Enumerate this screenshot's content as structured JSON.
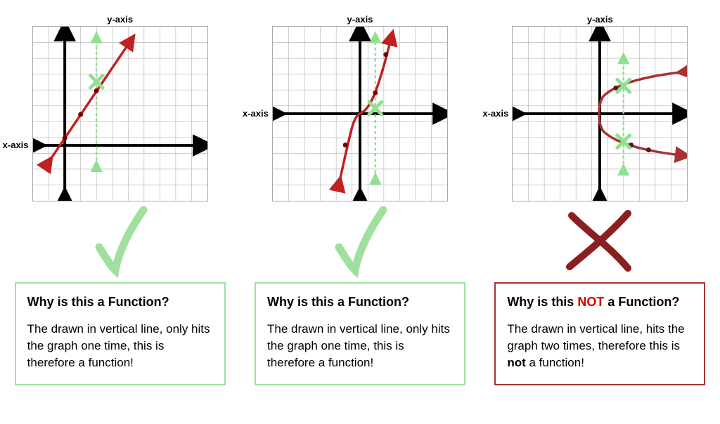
{
  "labels": {
    "x_axis": "x-axis",
    "y_axis": "y-axis"
  },
  "panels": [
    {
      "id": "linear",
      "question_prefix": "Why is this a ",
      "question_not": "",
      "question_suffix": "Function?",
      "explanation_a": "The drawn in vertical line, only hits the graph one time, this is therefore a ",
      "explanation_bold": "",
      "explanation_b": "function!",
      "result": "pass",
      "box_class": "green",
      "x_label_top": "162px"
    },
    {
      "id": "cubic",
      "question_prefix": "Why is this a ",
      "question_not": "",
      "question_suffix": "Function?",
      "explanation_a": "The drawn in vertical line, only hits the graph one time, this is therefore a ",
      "explanation_bold": "",
      "explanation_b": "function!",
      "result": "pass",
      "box_class": "green",
      "x_label_top": "117px"
    },
    {
      "id": "sideways-parabola",
      "question_prefix": "Why is this ",
      "question_not": "NOT",
      "question_suffix": " a Function?",
      "explanation_a": "The drawn in vertical line, hits the graph two times, therefore this is ",
      "explanation_bold": "not",
      "explanation_b": " a function!",
      "result": "fail",
      "box_class": "red",
      "x_label_top": "117px"
    }
  ],
  "chart_data": [
    {
      "type": "line",
      "title": "Linear function with vertical line test",
      "xlabel": "x-axis",
      "ylabel": "y-axis",
      "grid": true,
      "axes_intersection": {
        "x_at_row": 7,
        "y_at_col": 2,
        "grid_cols": 11,
        "grid_rows": 11
      },
      "series": [
        {
          "name": "graph-line",
          "color": "#c02020",
          "points": [
            {
              "x": -1,
              "y": -1
            },
            {
              "x": 3,
              "y": 6
            }
          ],
          "arrows": "both"
        },
        {
          "name": "vertical-test-line",
          "color": "#8fe08f",
          "style": "dashed",
          "x": 2,
          "y_range": [
            -1,
            7
          ],
          "arrows": "both"
        }
      ],
      "intersections": [
        {
          "x": 2,
          "y": 4.25,
          "mark": "x",
          "color": "#8fe08f"
        }
      ],
      "sample_points_on_curve": [
        {
          "x": 0,
          "y": 0.75
        },
        {
          "x": 1,
          "y": 2.5
        },
        {
          "x": 2,
          "y": 4.25
        }
      ]
    },
    {
      "type": "line",
      "title": "Cubic-like function with vertical line test",
      "xlabel": "x-axis",
      "ylabel": "y-axis",
      "grid": true,
      "axes_intersection": {
        "x_at_row": 5,
        "y_at_col": 5,
        "grid_cols": 11,
        "grid_rows": 11
      },
      "series": [
        {
          "name": "graph-curve",
          "color": "#c02020",
          "points": [
            {
              "x": -1.5,
              "y": -4
            },
            {
              "x": -0.5,
              "y": -0.1
            },
            {
              "x": 0.5,
              "y": 0.1
            },
            {
              "x": 1.5,
              "y": 4
            },
            {
              "x": 2,
              "y": 5.5
            }
          ],
          "arrows": "both"
        },
        {
          "name": "vertical-test-line",
          "color": "#8fe08f",
          "style": "dashed",
          "x": 1,
          "y_range": [
            -4,
            5
          ],
          "arrows": "both"
        }
      ],
      "intersections": [
        {
          "x": 1,
          "y": 0.5,
          "mark": "x",
          "color": "#8fe08f"
        }
      ],
      "sample_points_on_curve": [
        {
          "x": -1,
          "y": -1
        },
        {
          "x": 1,
          "y": 1
        },
        {
          "x": 1.7,
          "y": 4.5
        }
      ]
    },
    {
      "type": "line",
      "title": "Sideways parabola (not a function) with vertical line test",
      "xlabel": "x-axis",
      "ylabel": "y-axis",
      "grid": true,
      "axes_intersection": {
        "x_at_row": 5,
        "y_at_col": 5,
        "grid_cols": 11,
        "grid_rows": 11
      },
      "series": [
        {
          "name": "graph-curve-upper",
          "color": "#a83232",
          "points": [
            {
              "x": 0,
              "y": 0
            },
            {
              "x": 1,
              "y": 1.5
            },
            {
              "x": 3,
              "y": 2.3
            },
            {
              "x": 6,
              "y": 2.8
            }
          ],
          "arrows": "end"
        },
        {
          "name": "graph-curve-lower",
          "color": "#a83232",
          "points": [
            {
              "x": 0,
              "y": 0
            },
            {
              "x": 1,
              "y": -1.5
            },
            {
              "x": 3,
              "y": -2.3
            },
            {
              "x": 6,
              "y": -2.8
            }
          ],
          "arrows": "end"
        },
        {
          "name": "vertical-test-line",
          "color": "#8fe08f",
          "style": "dashed",
          "x": 1.5,
          "y_range": [
            -3.5,
            3.5
          ],
          "arrows": "both"
        }
      ],
      "intersections": [
        {
          "x": 1.5,
          "y": 1.8,
          "mark": "x",
          "color": "#8fe08f"
        },
        {
          "x": 1.5,
          "y": -1.8,
          "mark": "x",
          "color": "#8fe08f"
        }
      ],
      "sample_points_on_curve": [
        {
          "x": 1,
          "y": 1.5
        },
        {
          "x": 2,
          "y": -2
        },
        {
          "x": 3,
          "y": -2.3
        }
      ]
    }
  ]
}
